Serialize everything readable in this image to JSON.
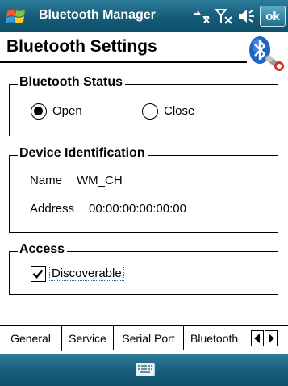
{
  "titlebar": {
    "app_title": "Bluetooth Manager",
    "ok_label": "ok",
    "icons": [
      "windows-start-icon",
      "connectivity-icon",
      "signal-off-icon",
      "speaker-icon"
    ]
  },
  "page": {
    "title": "Bluetooth Settings",
    "logo_icon": "bluetooth-settings-icon"
  },
  "status_group": {
    "legend": "Bluetooth Status",
    "options": [
      {
        "label": "Open",
        "checked": true
      },
      {
        "label": "Close",
        "checked": false
      }
    ]
  },
  "identity_group": {
    "legend": "Device Identification",
    "name_label": "Name",
    "name_value": "WM_CH",
    "address_label": "Address",
    "address_value": "00:00:00:00:00:00"
  },
  "access_group": {
    "legend": "Access",
    "discoverable_label": "Discoverable",
    "discoverable_checked": true
  },
  "tabs": {
    "items": [
      "General",
      "Service",
      "Serial Port",
      "Bluetooth"
    ],
    "active": "General"
  },
  "menubar": {
    "keyboard_icon": "keyboard-icon"
  },
  "colors": {
    "bar_blue": "#155c78",
    "bar_highlight": "#2d7c99"
  }
}
